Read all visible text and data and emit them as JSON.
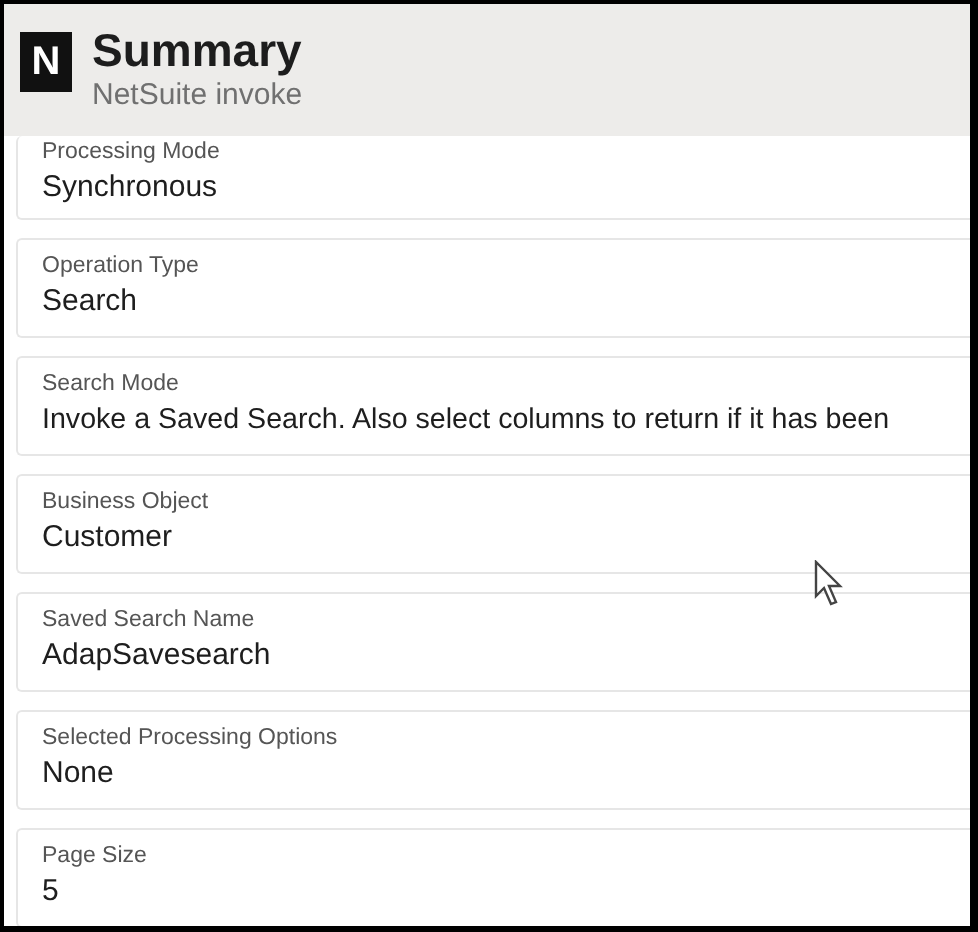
{
  "header": {
    "logo": "N",
    "title": "Summary",
    "subtitle": "NetSuite invoke"
  },
  "fields": [
    {
      "label": "Processing Mode",
      "value": "Synchronous"
    },
    {
      "label": "Operation Type",
      "value": "Search"
    },
    {
      "label": "Search Mode",
      "value": "Invoke a Saved Search. Also select columns to return if it has been"
    },
    {
      "label": "Business Object",
      "value": "Customer"
    },
    {
      "label": "Saved Search Name",
      "value": "AdapSavesearch"
    },
    {
      "label": "Selected Processing Options",
      "value": "None"
    },
    {
      "label": "Page Size",
      "value": "5"
    }
  ]
}
